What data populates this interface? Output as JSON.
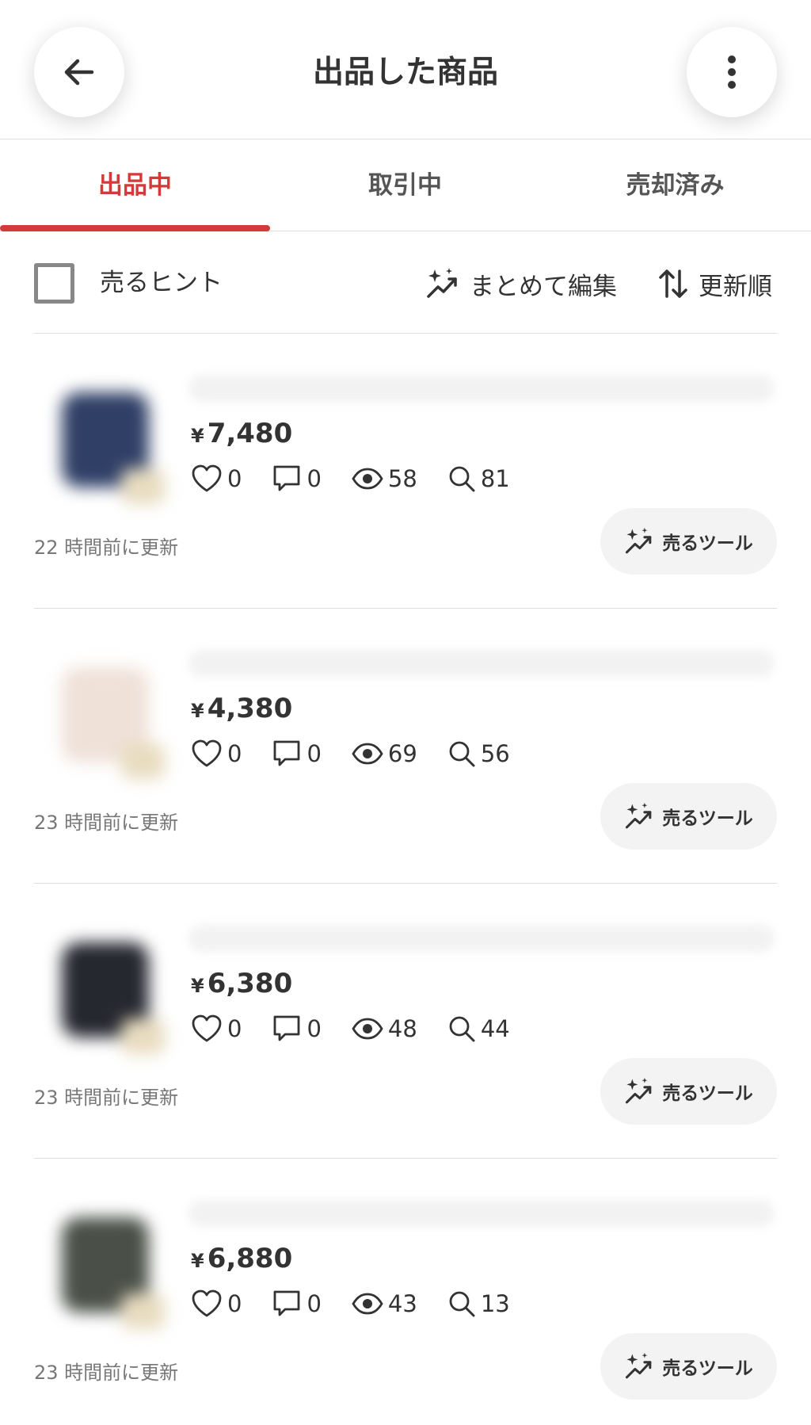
{
  "header": {
    "title": "出品した商品",
    "back_icon": "arrow-left-icon",
    "more_icon": "more-vertical-icon"
  },
  "tabs": [
    {
      "label": "出品中",
      "active": true
    },
    {
      "label": "取引中",
      "active": false
    },
    {
      "label": "売却済み",
      "active": false
    }
  ],
  "toolbar": {
    "hint_label": "売るヒント",
    "bulk_edit_label": "まとめて編集",
    "sort_label": "更新順"
  },
  "items": [
    {
      "yen": "¥",
      "price": "7,480",
      "likes": "0",
      "comments": "0",
      "views": "58",
      "searches": "81",
      "updated": "22 時間前に更新",
      "tool_label": "売るツール",
      "thumb_color": "#2f3f66"
    },
    {
      "yen": "¥",
      "price": "4,380",
      "likes": "0",
      "comments": "0",
      "views": "69",
      "searches": "56",
      "updated": "23 時間前に更新",
      "tool_label": "売るツール",
      "thumb_color": "#efe1d8"
    },
    {
      "yen": "¥",
      "price": "6,380",
      "likes": "0",
      "comments": "0",
      "views": "48",
      "searches": "44",
      "updated": "23 時間前に更新",
      "tool_label": "売るツール",
      "thumb_color": "#262830"
    },
    {
      "yen": "¥",
      "price": "6,880",
      "likes": "0",
      "comments": "0",
      "views": "43",
      "searches": "13",
      "updated": "23 時間前に更新",
      "tool_label": "売るツール",
      "thumb_color": "#4a5048"
    }
  ],
  "colors": {
    "accent": "#d53a3a",
    "text": "#333333",
    "muted": "#777777"
  }
}
